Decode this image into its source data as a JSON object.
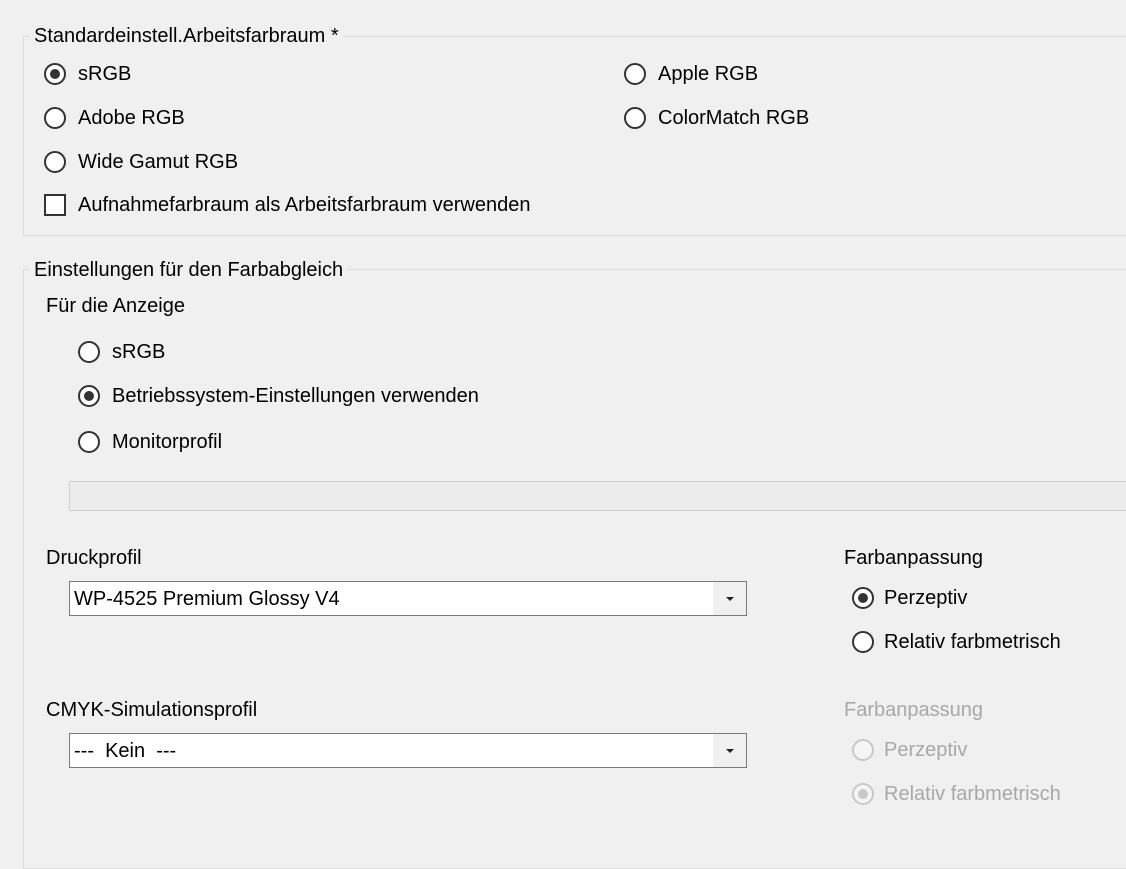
{
  "working_space": {
    "legend": "Standardeinstell.Arbeitsfarbraum *",
    "options": [
      {
        "label": "sRGB",
        "checked": true
      },
      {
        "label": "Apple RGB",
        "checked": false
      },
      {
        "label": "Adobe RGB",
        "checked": false
      },
      {
        "label": "ColorMatch RGB",
        "checked": false
      },
      {
        "label": "Wide Gamut RGB",
        "checked": false
      }
    ],
    "use_capture_space": {
      "label": "Aufnahmefarbraum als Arbeitsfarbraum verwenden",
      "checked": false
    }
  },
  "color_matching": {
    "legend": "Einstellungen für den Farbabgleich",
    "display": {
      "label": "Für die Anzeige",
      "options": [
        {
          "label": "sRGB",
          "checked": false
        },
        {
          "label": "Betriebssystem-Einstellungen verwenden",
          "checked": true
        },
        {
          "label": "Monitorprofil",
          "checked": false
        }
      ],
      "monitor_profile_value": ""
    },
    "print_profile": {
      "label": "Druckprofil",
      "value": "WP-4525 Premium Glossy V4"
    },
    "print_rendering": {
      "label": "Farbanpassung",
      "options": [
        {
          "label": "Perzeptiv",
          "checked": true,
          "enabled": true
        },
        {
          "label": "Relativ farbmetrisch",
          "checked": false,
          "enabled": true
        }
      ]
    },
    "cmyk_profile": {
      "label": "CMYK-Simulationsprofil",
      "value": "---  Kein  ---"
    },
    "cmyk_rendering": {
      "label": "Farbanpassung",
      "options": [
        {
          "label": "Perzeptiv",
          "checked": false,
          "enabled": false
        },
        {
          "label": "Relativ farbmetrisch",
          "checked": true,
          "enabled": false
        }
      ]
    }
  },
  "colors": {
    "background": "#f0f0f0",
    "disabled_text": "#a8a8a8",
    "group_border": "#dcdcdc"
  }
}
